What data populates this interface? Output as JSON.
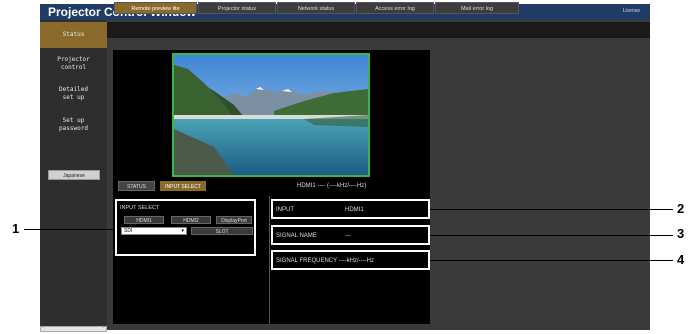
{
  "window": {
    "title": "Projector Control Window",
    "license_link": "License"
  },
  "sidebar": {
    "items": [
      {
        "label": "Status"
      },
      {
        "label": "Projector\ncontrol"
      },
      {
        "label": "Detailed\nset up"
      },
      {
        "label": "Set up\npassword"
      }
    ],
    "language_button": "Japanese"
  },
  "tabs": [
    {
      "label": "Remote preview lite",
      "active": true
    },
    {
      "label": "Projector status",
      "active": false
    },
    {
      "label": "Network status",
      "active": false
    },
    {
      "label": "Access error log",
      "active": false
    },
    {
      "label": "Mail error log",
      "active": false
    }
  ],
  "preview": {
    "status_button": "STATUS",
    "input_select_button": "INPUT SELECT",
    "signal_header": "HDMI1 ---- (----kHz/----Hz)"
  },
  "input_select": {
    "title": "INPUT SELECT",
    "buttons": [
      "HDMI1",
      "HDMI2",
      "DisplayPort"
    ],
    "dropdown_value": "SDI",
    "slot_button": "SLOT"
  },
  "info": {
    "input_label": "INPUT",
    "input_value": "HDMI1",
    "signal_name_label": "SIGNAL NAME",
    "signal_name_value": "---",
    "signal_frequency": "SIGNAL FREQUENCY ----kHz/----Hz"
  },
  "callouts": [
    "1",
    "2",
    "3",
    "4"
  ],
  "colors": {
    "title_bar": "#1f3b66",
    "active_tab": "#8a6a2c",
    "preview_border": "#3bb54a"
  }
}
